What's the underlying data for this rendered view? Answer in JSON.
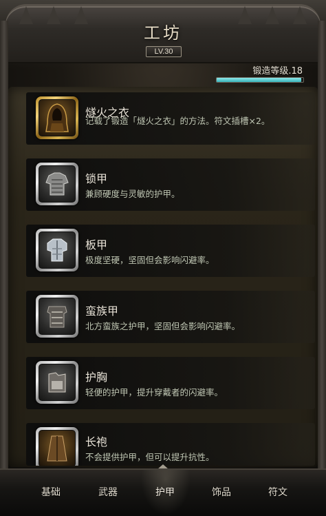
{
  "header": {
    "title": "工坊",
    "level": "LV.30"
  },
  "forge": {
    "label": "锻造等级.18",
    "progress": 0.98
  },
  "recipes": [
    {
      "name": "燧火之衣",
      "desc": "记载了锻造「燧火之衣」的方法。符文插槽×2。",
      "icon": "hooded-cloak-icon"
    },
    {
      "name": "锁甲",
      "desc": "兼顾硬度与灵敏的护甲。",
      "icon": "chainmail-armor-icon"
    },
    {
      "name": "板甲",
      "desc": "极度坚硬，坚固但会影响闪避率。",
      "icon": "plate-armor-icon"
    },
    {
      "name": "蛮族甲",
      "desc": "北方蛮族之护甲，坚固但会影响闪避率。",
      "icon": "barbarian-armor-icon"
    },
    {
      "name": "护胸",
      "desc": "轻便的护甲，提升穿戴者的闪避率。",
      "icon": "breastplate-icon"
    },
    {
      "name": "长袍",
      "desc": "不会提供护甲，但可以提升抗性。",
      "icon": "robe-icon"
    }
  ],
  "tabs": [
    {
      "label": "基础"
    },
    {
      "label": "武器"
    },
    {
      "label": "护甲",
      "active": true
    },
    {
      "label": "饰品"
    },
    {
      "label": "符文"
    }
  ]
}
